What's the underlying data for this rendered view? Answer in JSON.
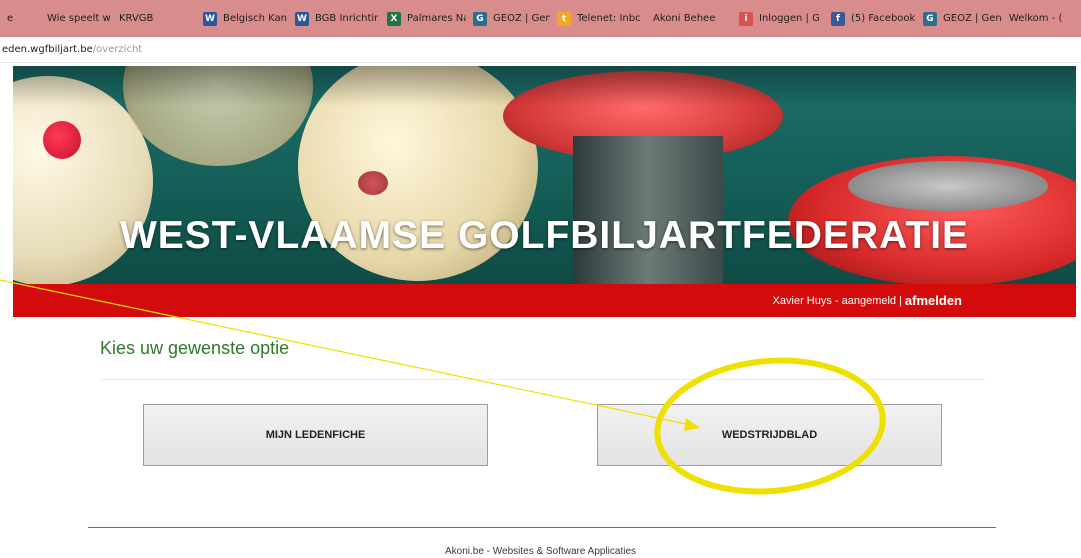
{
  "bookmarks": [
    {
      "label": "e",
      "icon": "none",
      "color": ""
    },
    {
      "label": "Wie speelt w",
      "icon": "none",
      "color": ""
    },
    {
      "label": "KRVGB",
      "icon": "none",
      "color": ""
    },
    {
      "label": "Belgisch Kan",
      "icon": "word-icon",
      "color": "#2b579a"
    },
    {
      "label": "BGB Inrichtir",
      "icon": "word-icon",
      "color": "#2b579a"
    },
    {
      "label": "Palmares Na",
      "icon": "excel-icon",
      "color": "#217346"
    },
    {
      "label": "GEOZ | Gent",
      "icon": "geoz-icon",
      "color": "#2a6f8f"
    },
    {
      "label": "Telenet: Inbc",
      "icon": "telenet-icon",
      "color": "#f5a623"
    },
    {
      "label": "Akoni Behee",
      "icon": "none",
      "color": ""
    },
    {
      "label": "Inloggen | G",
      "icon": "login-icon",
      "color": "#d9534f"
    },
    {
      "label": "(5) Facebook",
      "icon": "facebook-icon",
      "color": "#3b5998"
    },
    {
      "label": "GEOZ | Gent",
      "icon": "geoz-icon",
      "color": "#2a6f8f"
    },
    {
      "label": "Welkom - (",
      "icon": "none",
      "color": ""
    }
  ],
  "address": {
    "host": "eden.wgfbiljart.be",
    "path": "/overzicht"
  },
  "banner": {
    "title": "WEST-VLAAMSE GOLFBILJARTFEDERATIE"
  },
  "userbar": {
    "user": "Xavier Huys - aangemeld",
    "separator": "|",
    "logout": "afmelden"
  },
  "main": {
    "heading": "Kies uw gewenste optie",
    "button_ledenfiche": "MIJN LEDENFICHE",
    "button_wedstrijdblad": "WEDSTRIJDBLAD"
  },
  "footer": {
    "text": "Akoni.be - Websites & Software Applicaties"
  },
  "colors": {
    "redbar": "#d40b0b",
    "heading": "#2f7a2a",
    "bookmarks_bg": "#d98c8c",
    "highlight": "#f0e000"
  }
}
